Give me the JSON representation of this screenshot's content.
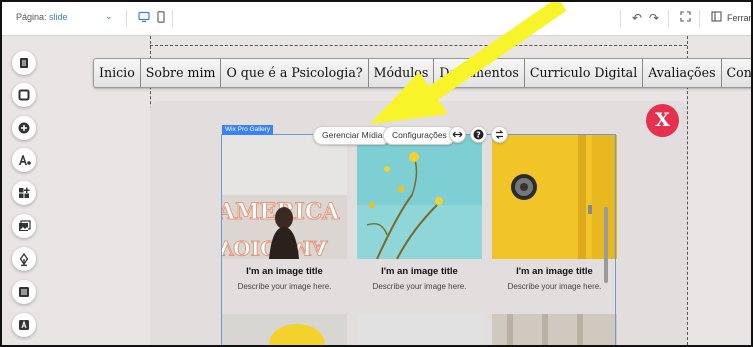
{
  "editor": {
    "page_label": "Página:",
    "page_value": "slide",
    "tools_label": "Ferram"
  },
  "toolbar_icons": [
    "desktop-icon",
    "mobile-icon",
    "undo-icon",
    "redo-icon",
    "fit-icon",
    "tools-panel-icon"
  ],
  "left_toolbar": [
    "pages-icon",
    "background-icon",
    "add-icon",
    "theme-icon",
    "apps-icon",
    "media-icon",
    "blog-icon",
    "list-icon",
    "text-icon"
  ],
  "site_menu": [
    "Inicio",
    "Sobre mim",
    "O que é a Psicologia?",
    "Módulos",
    "Documentos",
    "Curriculo Digital",
    "Avaliações",
    "Contacto"
  ],
  "gallery": {
    "tag": "Wix Pro Gallery",
    "manage_media": "Gerenciar Mídia",
    "settings": "Configurações",
    "close_label": "X",
    "items": [
      {
        "title": "I'm an image title",
        "description": "Describe your image here."
      },
      {
        "title": "I'm an image title",
        "description": "Describe your image here."
      },
      {
        "title": "I'm an image title",
        "description": "Describe your image here."
      }
    ]
  },
  "colors": {
    "accent": "#3b7bd8",
    "arrow": "#f7f52a",
    "close": "#e5304f",
    "yellow_door": "#f1c427"
  }
}
